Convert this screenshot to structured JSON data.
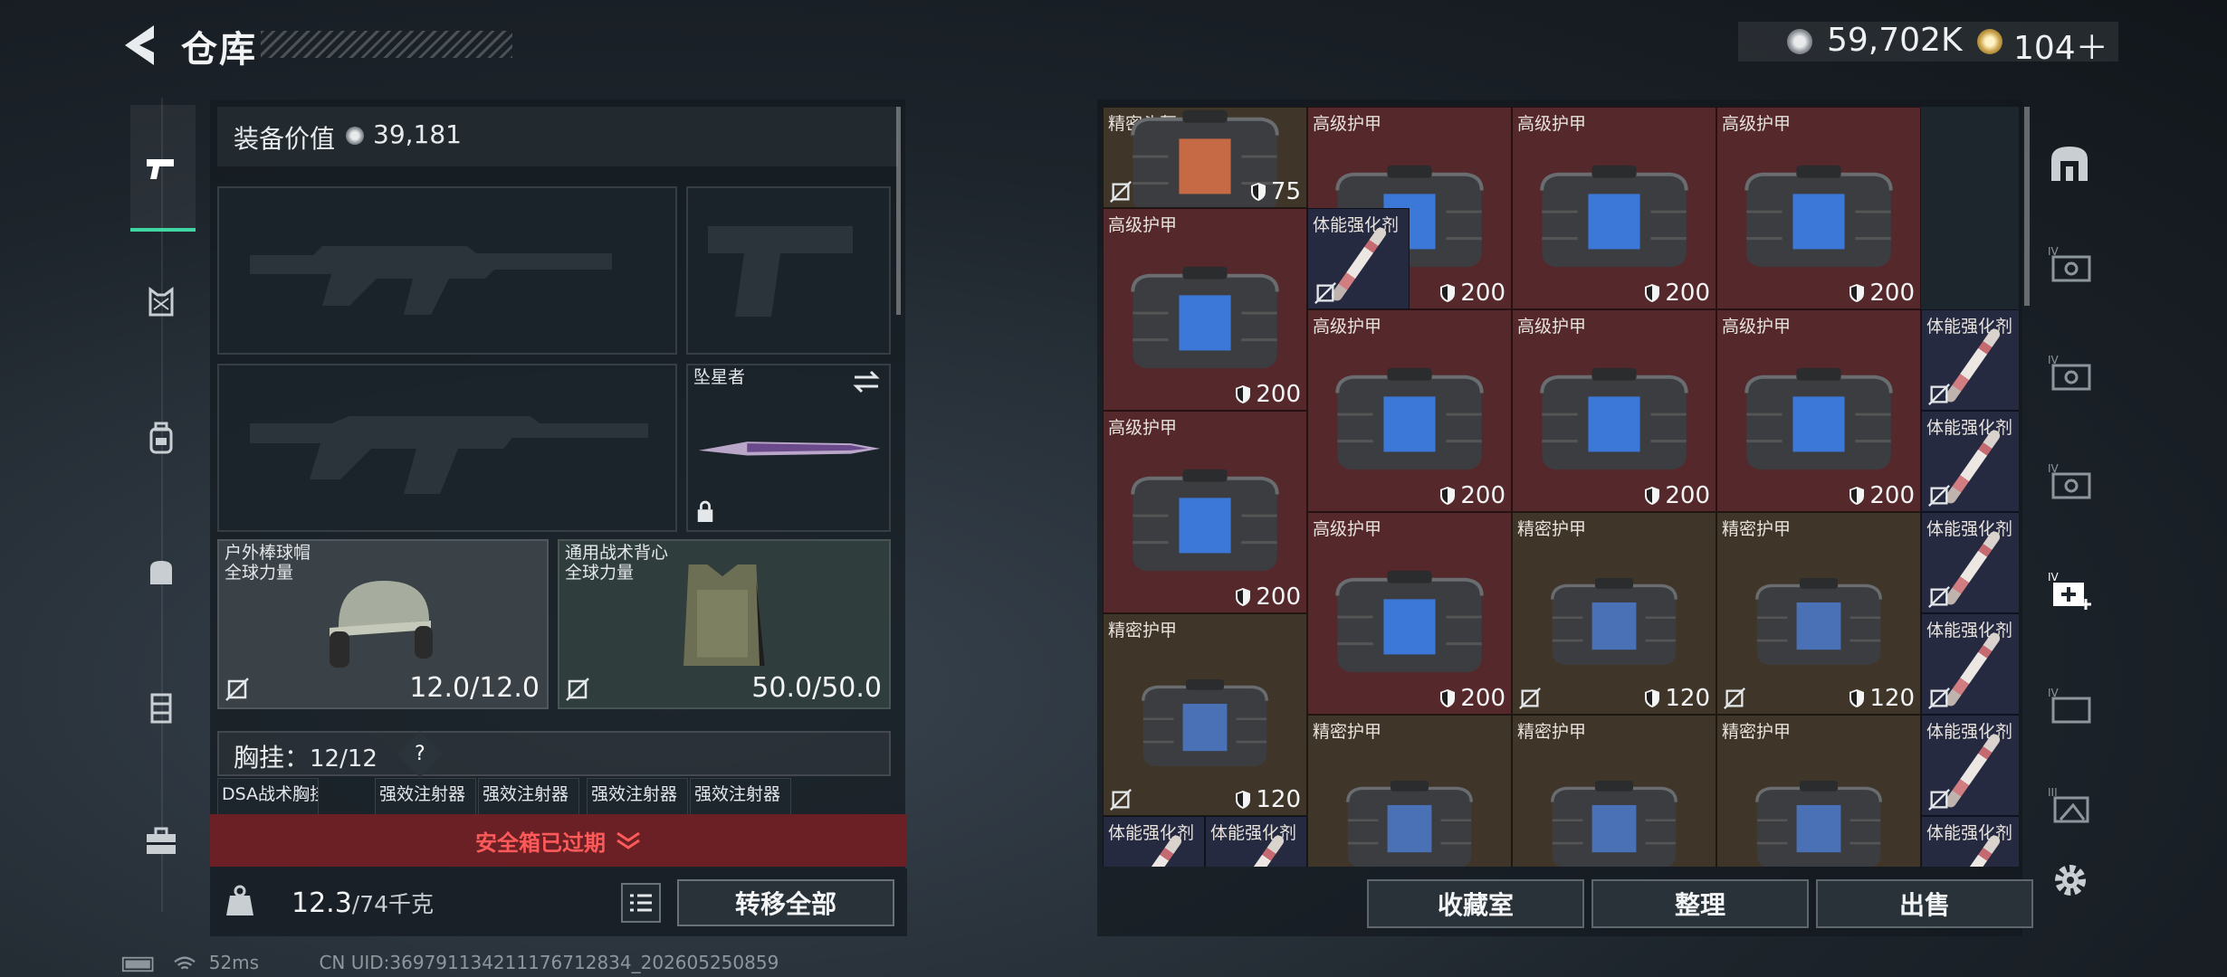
{
  "header": {
    "title": "仓库",
    "currency_silver": "59,702K",
    "currency_gold": "104＋"
  },
  "equipment": {
    "value_label": "装备价值",
    "value": "39,181",
    "melee_name": "坠星者",
    "helmet": {
      "name": "户外棒球帽",
      "brand": "全球力量",
      "durability": "12.0/12.0"
    },
    "armor": {
      "name": "通用战术背心",
      "brand": "全球力量",
      "durability": "50.0/50.0"
    },
    "chest_label": "胸挂：",
    "chest_count": "12/12",
    "chest_help": "?",
    "chest_slots": [
      "DSA战术胸挂",
      "强效注射器",
      "强效注射器",
      "强效注射器",
      "强效注射器"
    ],
    "safebox_expired": "安全箱已过期",
    "weight_value": "12.3",
    "weight_max": "/74千克",
    "transfer_all": "转移全部"
  },
  "storage": {
    "items": [
      {
        "name": "精密头盔",
        "value": "75",
        "kind": "helmet",
        "color": "brown",
        "nosell": true
      },
      {
        "name": "高级护甲",
        "value": "200",
        "kind": "vest",
        "color": "red"
      },
      {
        "name": "高级护甲",
        "value": "200",
        "kind": "vest",
        "color": "red"
      },
      {
        "name": "高级护甲",
        "value": "200",
        "kind": "vest",
        "color": "red"
      },
      {
        "name": "高级护甲",
        "value": "200",
        "kind": "vest",
        "color": "red"
      },
      {
        "name": "体能强化剂",
        "value": "",
        "kind": "syringe",
        "color": "blue",
        "nosell": true
      },
      {
        "name": "高级护甲",
        "value": "200",
        "kind": "vest",
        "color": "red"
      },
      {
        "name": "高级护甲",
        "value": "200",
        "kind": "vest",
        "color": "red"
      },
      {
        "name": "高级护甲",
        "value": "200",
        "kind": "vest",
        "color": "red"
      },
      {
        "name": "体能强化剂",
        "value": "",
        "kind": "syringe",
        "color": "blue",
        "nosell": true
      },
      {
        "name": "高级护甲",
        "value": "200",
        "kind": "vest",
        "color": "red"
      },
      {
        "name": "体能强化剂",
        "value": "",
        "kind": "syringe",
        "color": "blue",
        "nosell": true
      },
      {
        "name": "高级护甲",
        "value": "200",
        "kind": "vest",
        "color": "red"
      },
      {
        "name": "精密护甲",
        "value": "120",
        "kind": "vest-s",
        "color": "brown",
        "nosell": true
      },
      {
        "name": "精密护甲",
        "value": "120",
        "kind": "vest-s",
        "color": "brown",
        "nosell": true
      },
      {
        "name": "体能强化剂",
        "value": "",
        "kind": "syringe",
        "color": "blue",
        "nosell": true
      },
      {
        "name": "精密护甲",
        "value": "120",
        "kind": "vest-s",
        "color": "brown",
        "nosell": true
      },
      {
        "name": "体能强化剂",
        "value": "",
        "kind": "syringe",
        "color": "blue",
        "nosell": true
      },
      {
        "name": "精密护甲",
        "value": "",
        "kind": "vest-s",
        "color": "brown"
      },
      {
        "name": "精密护甲",
        "value": "",
        "kind": "vest-s",
        "color": "brown"
      },
      {
        "name": "精密护甲",
        "value": "",
        "kind": "vest-s",
        "color": "brown"
      },
      {
        "name": "体能强化剂",
        "value": "",
        "kind": "syringe",
        "color": "blue",
        "nosell": true
      },
      {
        "name": "体能强化剂",
        "value": "",
        "kind": "syringe",
        "color": "blue"
      },
      {
        "name": "体能强化剂",
        "value": "",
        "kind": "syringe",
        "color": "blue"
      },
      {
        "name": "体能强化剂",
        "value": "",
        "kind": "syringe",
        "color": "blue"
      }
    ],
    "buttons": [
      "收藏室",
      "整理",
      "出售"
    ]
  },
  "rail_labels": [
    "IV",
    "IV",
    "IV",
    "IV",
    "IV",
    "III"
  ],
  "status": {
    "ping": "52ms",
    "uid": "CN UID:369791134211176712834_202605250859"
  },
  "colors": {
    "accent": "#3fd6a4",
    "tier_red": "#55282c",
    "tier_brown": "#3f3629",
    "tier_blue": "#252a40",
    "expired_bg": "#6a2024",
    "expired_text": "#ff5a5a"
  },
  "icons": [
    "back-arrow-icon",
    "silver-coin-icon",
    "gold-coin-icon",
    "pistol-icon",
    "chest-rig-icon",
    "backpack-icon",
    "bag-icon",
    "locker-icon",
    "briefcase-icon",
    "no-sell-icon",
    "shield-icon",
    "swap-icon",
    "lock-icon",
    "weight-icon",
    "list-icon",
    "gear-icon"
  ]
}
